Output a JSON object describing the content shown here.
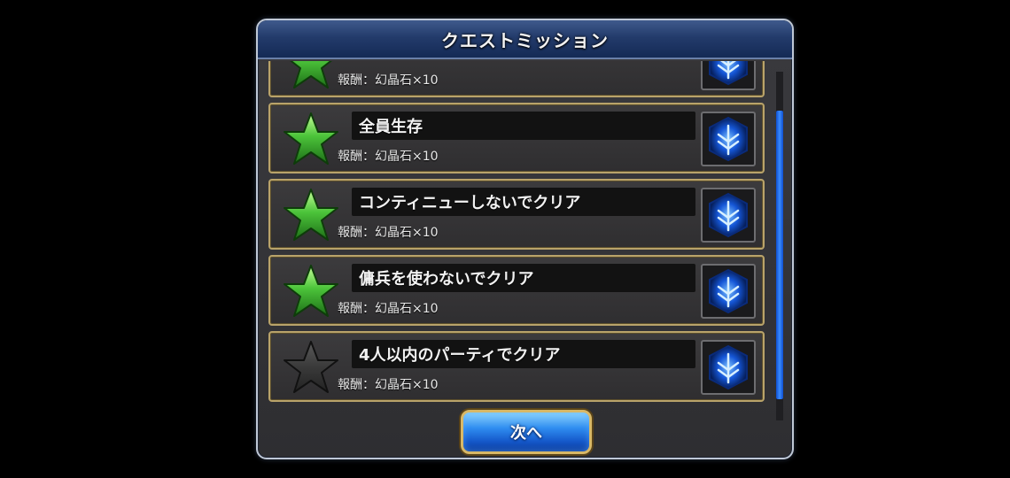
{
  "dialog": {
    "title": "クエストミッション",
    "next_label": "次へ"
  },
  "missions": [
    {
      "name": "",
      "reward": "報酬：幻晶石×10",
      "achieved": true
    },
    {
      "name": "全員生存",
      "reward": "報酬：幻晶石×10",
      "achieved": true
    },
    {
      "name": "コンティニューしないでクリア",
      "reward": "報酬：幻晶石×10",
      "achieved": true
    },
    {
      "name": "傭兵を使わないでクリア",
      "reward": "報酬：幻晶石×10",
      "achieved": true
    },
    {
      "name": "4人以内のパーティでクリア",
      "reward": "報酬：幻晶石×10",
      "achieved": false
    }
  ],
  "icons": {
    "achieved_star": "star-green-icon",
    "unachieved_star": "star-gray-icon",
    "reward_item": "crystal-icon"
  },
  "colors": {
    "title_bar": "#233b6b",
    "row_border": "#b9a36a",
    "star_achieved": "#4cc43a",
    "star_unachieved": "#3a3a3a",
    "scrollbar": "#3a8bff",
    "button": "#2f8df0"
  }
}
